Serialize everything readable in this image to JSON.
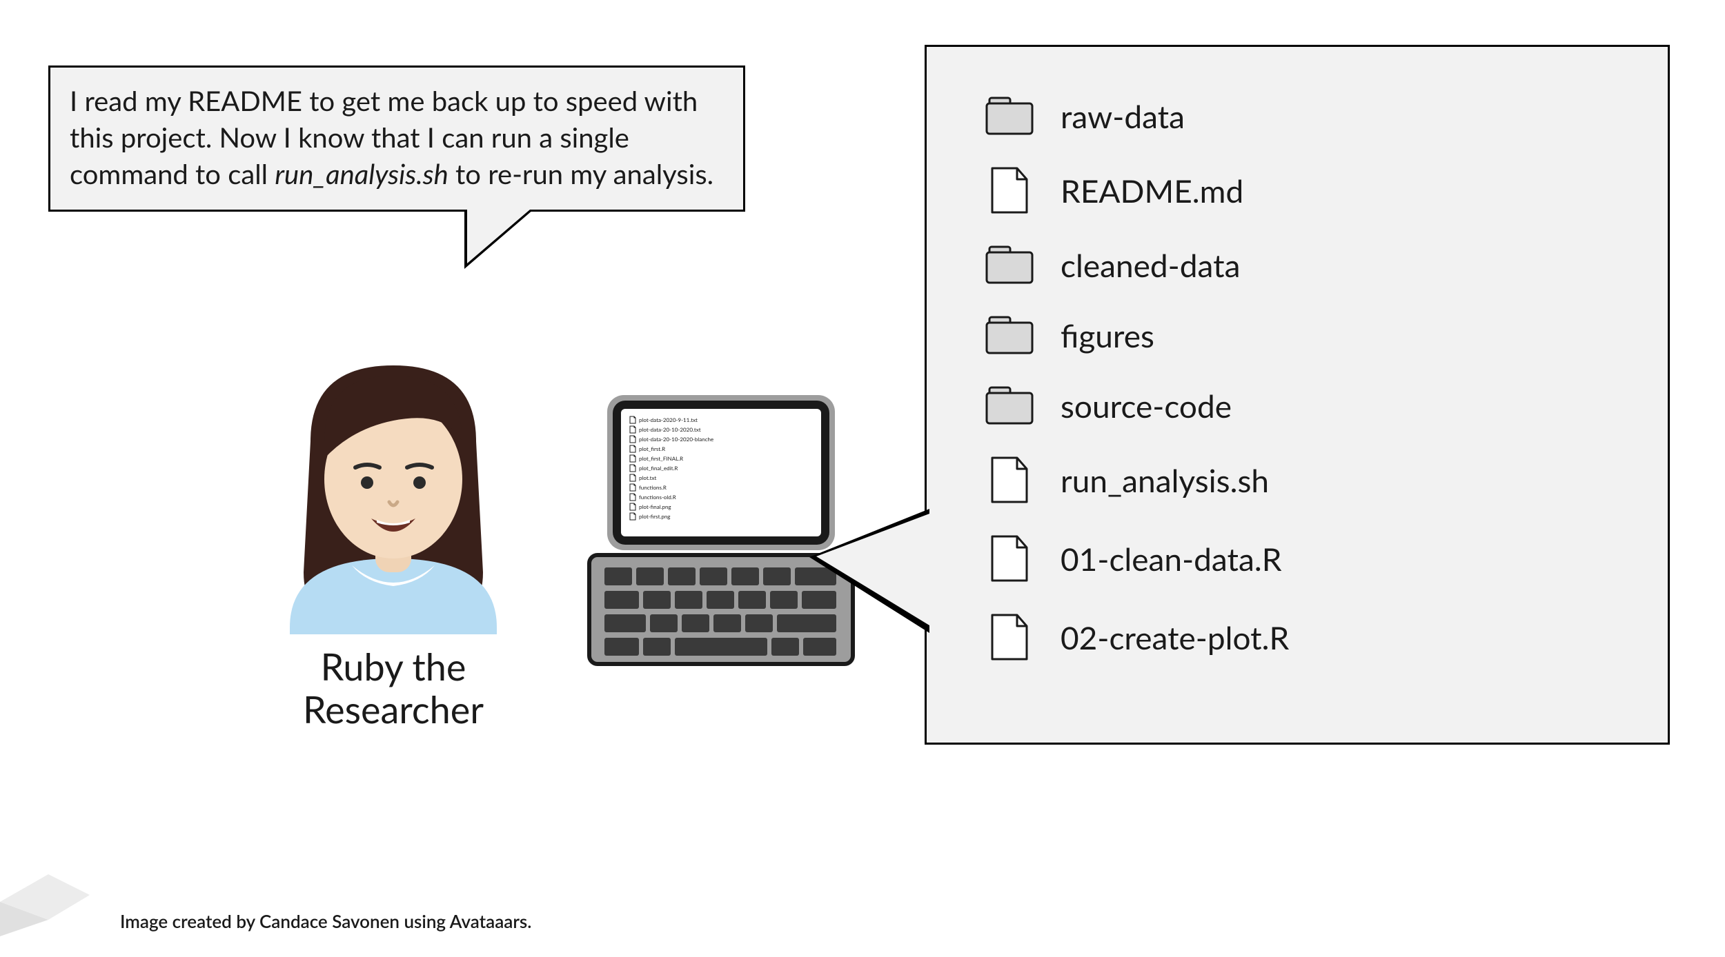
{
  "speech": {
    "line1": "I read my README to get me back up to speed with",
    "line2": "this project. Now I know that I can run a single",
    "line3_a": "command to call ",
    "line3_italic": "run_analysis.sh",
    "line3_b": " to re-run my analysis."
  },
  "avatar": {
    "name_line1": "Ruby the",
    "name_line2": "Researcher"
  },
  "file_panel": {
    "items": [
      {
        "icon": "folder",
        "label": "raw-data"
      },
      {
        "icon": "file",
        "label": "README.md"
      },
      {
        "icon": "folder",
        "label": "cleaned-data"
      },
      {
        "icon": "folder",
        "label": "figures"
      },
      {
        "icon": "folder",
        "label": "source-code"
      },
      {
        "icon": "file",
        "label": "run_analysis.sh"
      },
      {
        "icon": "file",
        "label": "01-clean-data.R"
      },
      {
        "icon": "file",
        "label": "02-create-plot.R"
      }
    ]
  },
  "laptop_files": [
    "plot-data-2020-9-11.txt",
    "plot-data-20-10-2020.txt",
    "plot-data-20-10-2020-blanche",
    "plot_first.R",
    "plot_first_FINAL.R",
    "plot_final_edit.R",
    "plot.txt",
    "functions.R",
    "functions-old.R",
    "plot-final.png",
    "plot-first.png"
  ],
  "credit": "Image created by Candace Savonen using Avataaars."
}
